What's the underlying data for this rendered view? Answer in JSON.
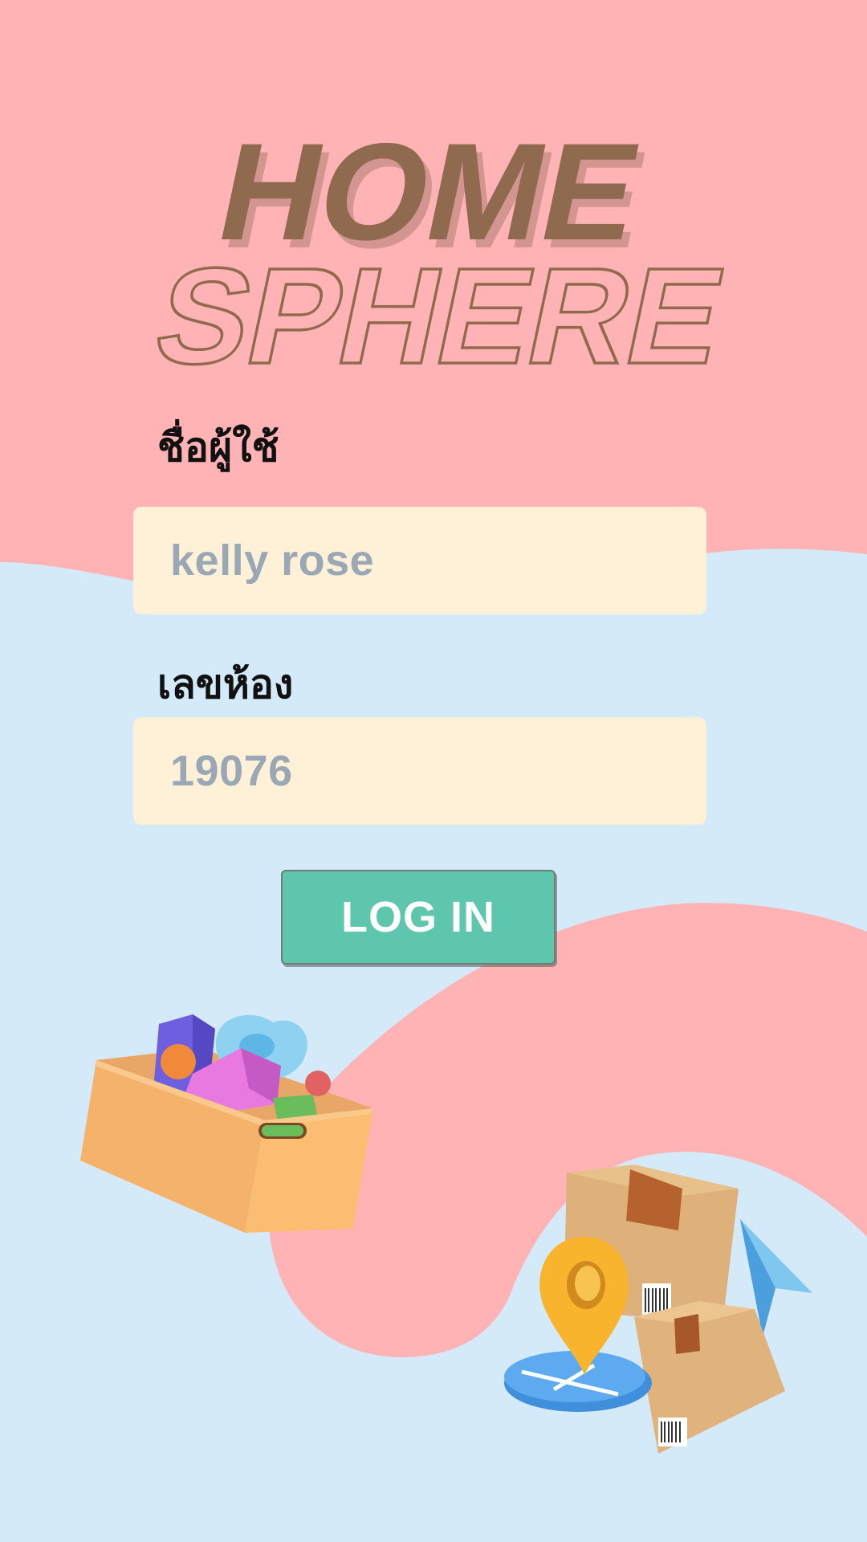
{
  "app": {
    "title_line1": "HOME",
    "title_line2": "SPHERE"
  },
  "form": {
    "username_label": "ชื่อผู้ใช้",
    "username_value": "kelly rose",
    "room_label": "เลขห้อง",
    "room_value": "19076",
    "login_label": "LOG IN"
  },
  "colors": {
    "pink_background": "#ffb3b5",
    "blue_background": "#d4eaf8",
    "logo_brown": "#8f6a4e",
    "field_fill": "#fff0d8",
    "field_text": "#9aa8b5",
    "button_green": "#5ec6ac",
    "button_text": "#ffffff"
  },
  "icons": {
    "toy_box": "toy-box-illustration",
    "delivery": "delivery-boxes-location-pin-illustration"
  }
}
